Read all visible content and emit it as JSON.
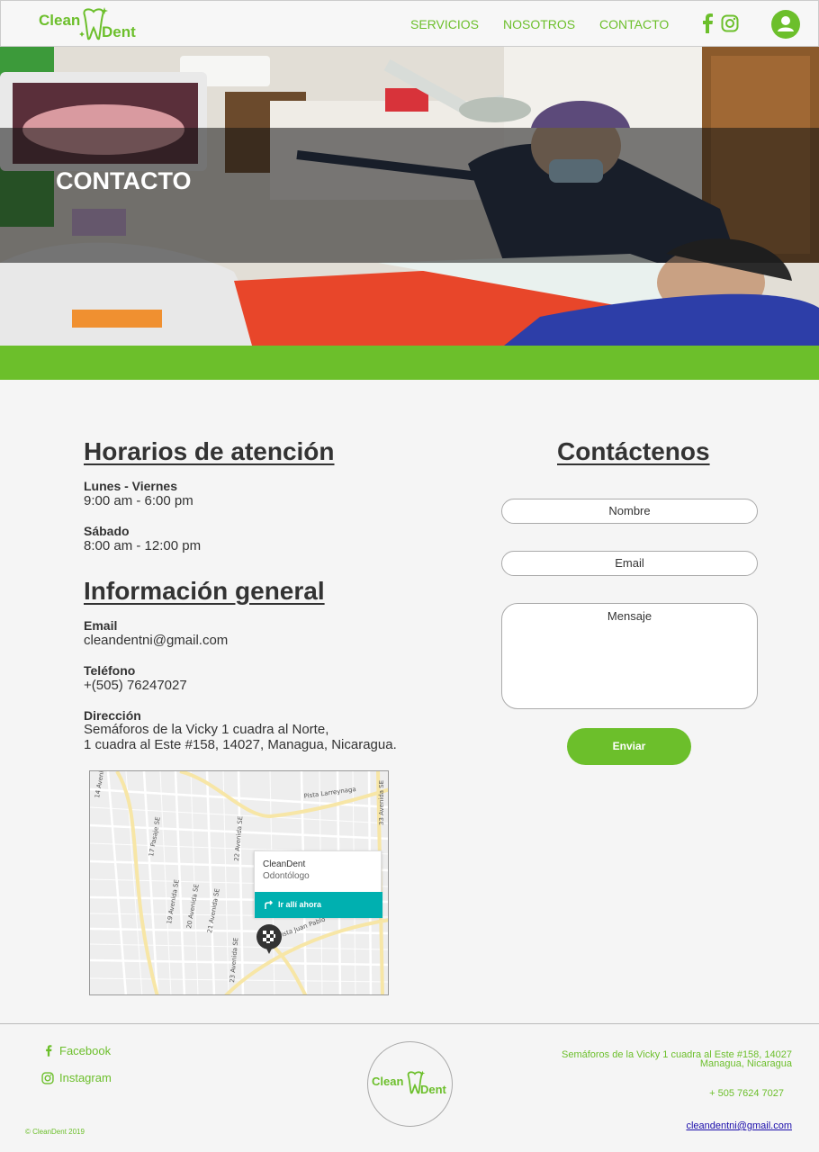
{
  "nav": {
    "logo_word1": "Clean",
    "logo_word2": "Dent",
    "links": [
      "SERVICIOS",
      "NOSOTROS",
      "CONTACTO"
    ],
    "icons": [
      "facebook-icon",
      "instagram-icon",
      "account-icon"
    ]
  },
  "hero": {
    "title": "CONTACTO"
  },
  "hours": {
    "heading": "Horarios de atención",
    "items": [
      {
        "label": "Lunes - Viernes",
        "value": "9:00 am - 6:00 pm"
      },
      {
        "label": "Sábado",
        "value": "8:00 am - 12:00 pm"
      }
    ]
  },
  "info": {
    "heading": "Información general",
    "email_label": "Email",
    "email_value": "cleandentni@gmail.com",
    "phone_label": "Teléfono",
    "phone_value": "+(505) 76247027",
    "address_label": "Dirección",
    "address_line1": "Semáforos de la Vicky 1 cuadra al Norte,",
    "address_line2": "1 cuadra al Este #158, 14027, Managua, Nicaragua."
  },
  "map": {
    "place_name": "CleanDent",
    "place_category": "Odontólogo",
    "directions_label": "Ir allí ahora",
    "street_labels": [
      "Pista Larreynaga",
      "Pista Juan Pablo",
      "33 Avenida SE",
      "17 Pasaje SE",
      "19 Avenida SE",
      "20 Avenida SE",
      "21 Avenida SE",
      "22 Avenida SE",
      "23 Avenida SE",
      "14 Avenida"
    ]
  },
  "contact_form": {
    "heading": "Contáctenos",
    "name_placeholder": "Nombre",
    "email_placeholder": "Email",
    "message_placeholder": "Mensaje",
    "submit_label": "Enviar"
  },
  "footer": {
    "facebook_label": "Facebook",
    "instagram_label": "Instagram",
    "copyright": "© CleanDent 2019",
    "address_line1": "Semáforos de la Vicky 1 cuadra al Este #158, 14027",
    "address_line2": "Managua, Nicaragua",
    "phone": "+ 505 7624 7027",
    "email": "cleandentni@gmail.com",
    "logo_word1": "Clean",
    "logo_word2": "Dent"
  },
  "colors": {
    "brand_green": "#6cbf2b",
    "teal": "#00b0b0",
    "text_dark": "#333333"
  }
}
